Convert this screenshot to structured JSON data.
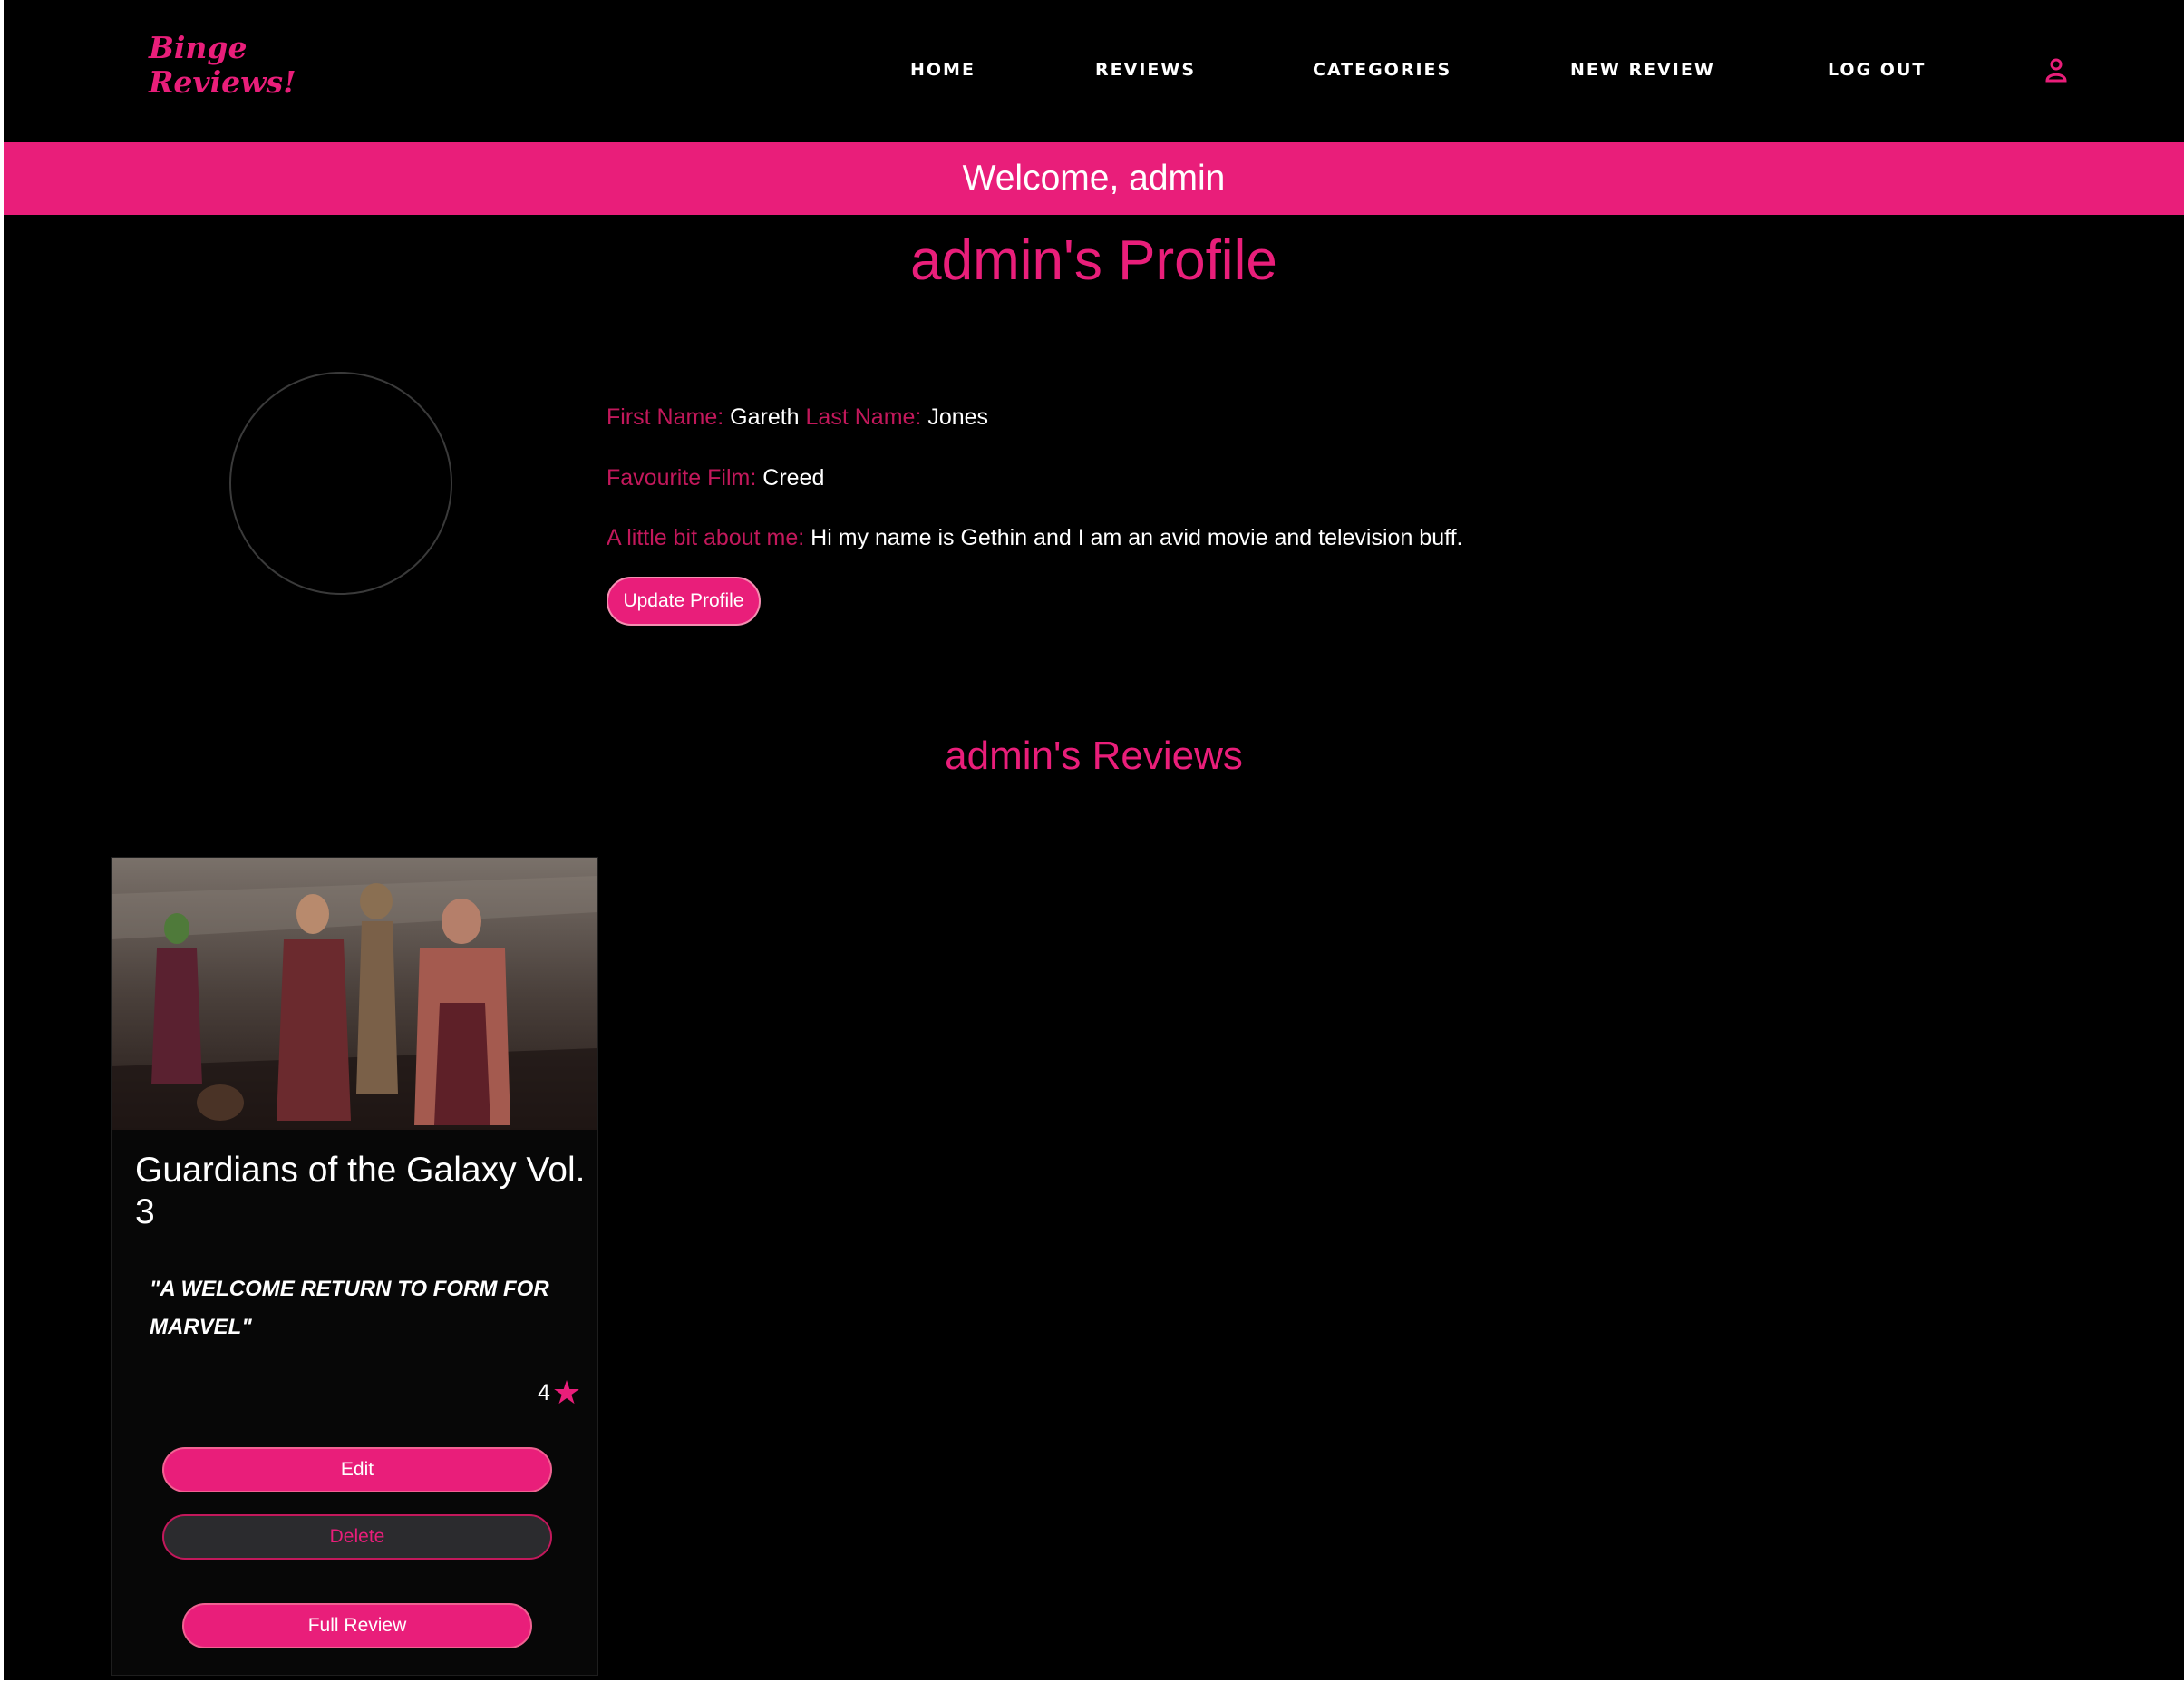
{
  "brand": {
    "line1": "Binge",
    "line2": "Reviews!"
  },
  "nav": {
    "items": [
      {
        "label": "HOME"
      },
      {
        "label": "REVIEWS"
      },
      {
        "label": "CATEGORIES"
      },
      {
        "label": "NEW REVIEW"
      },
      {
        "label": "LOG OUT"
      }
    ],
    "user_icon": "user-icon"
  },
  "welcome": {
    "text": "Welcome, admin"
  },
  "profile": {
    "title": "admin's Profile",
    "avatar_icon": "avatar-circle",
    "first_name_label": "First Name:",
    "first_name": "Gareth",
    "last_name_label": "Last Name:",
    "last_name": "Jones",
    "fav_film_label": "Favourite Film:",
    "fav_film": "Creed",
    "about_label": "A little bit about me:",
    "about": "Hi my name is Gethin and I am an avid movie and television buff.",
    "update_label": "Update Profile"
  },
  "reviews": {
    "title": "admin's Reviews",
    "cards": [
      {
        "title": "Guardians of the Galaxy Vol. 3",
        "quote": "\"A welcome return to form for Marvel\"",
        "rating": "4",
        "rating_icon": "star-icon",
        "edit_label": "Edit",
        "delete_label": "Delete",
        "full_label": "Full Review"
      }
    ]
  },
  "colors": {
    "accent": "#e91e7a",
    "label": "#c2185b",
    "background": "#000000",
    "text": "#ffffff"
  }
}
